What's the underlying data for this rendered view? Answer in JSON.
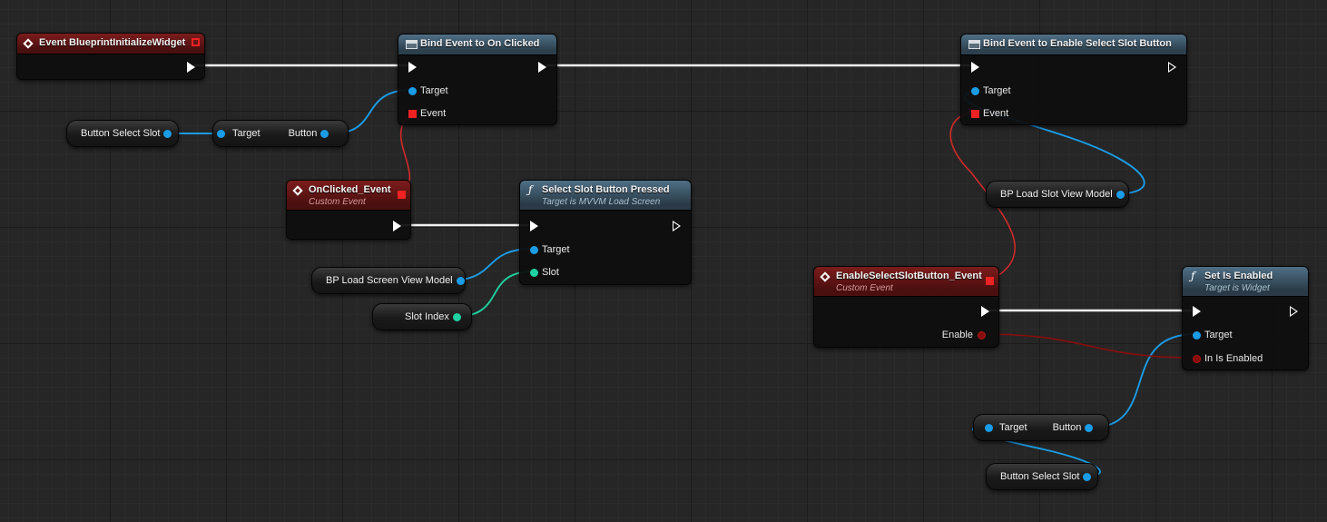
{
  "nodes": {
    "event_init": {
      "title": "Event BlueprintInitializeWidget"
    },
    "bind_onclicked": {
      "title": "Bind Event to On Clicked",
      "pin_target": "Target",
      "pin_event": "Event"
    },
    "get_button_1": {
      "pin_target": "Target",
      "pin_button": "Button"
    },
    "var_button_select_slot_1": {
      "label": "Button Select Slot"
    },
    "onclicked_event": {
      "title": "OnClicked_Event",
      "subtitle": "Custom Event"
    },
    "select_slot_pressed": {
      "title": "Select Slot Button Pressed",
      "subtitle": "Target is MVVM Load Screen",
      "pin_target": "Target",
      "pin_slot": "Slot"
    },
    "var_bp_load_screen_vm": {
      "label": "BP Load Screen View Model"
    },
    "var_slot_index": {
      "label": "Slot Index"
    },
    "bind_enable_select": {
      "title": "Bind Event to Enable Select Slot Button",
      "pin_target": "Target",
      "pin_event": "Event"
    },
    "var_bp_load_slot_vm": {
      "label": "BP Load Slot View Model"
    },
    "enable_select_event": {
      "title": "EnableSelectSlotButton_Event",
      "subtitle": "Custom Event",
      "pin_enable": "Enable"
    },
    "set_is_enabled": {
      "title": "Set Is Enabled",
      "subtitle": "Target is Widget",
      "pin_target": "Target",
      "pin_in_is_enabled": "In Is Enabled"
    },
    "get_button_2": {
      "pin_target": "Target",
      "pin_button": "Button"
    },
    "var_button_select_slot_2": {
      "label": "Button Select Slot"
    }
  },
  "colors": {
    "exec": "#f2f2f2",
    "object": "#1b9ce6",
    "delegate": "#d12a2a",
    "boolean": "#8a0d0d",
    "integer": "#1fd1a0",
    "event_header": "#7d1c1c",
    "function_header": "#4f6f86"
  },
  "icons": {
    "event": "event-diamond-icon",
    "function": "function-f-icon",
    "bind": "bind-event-icon"
  }
}
